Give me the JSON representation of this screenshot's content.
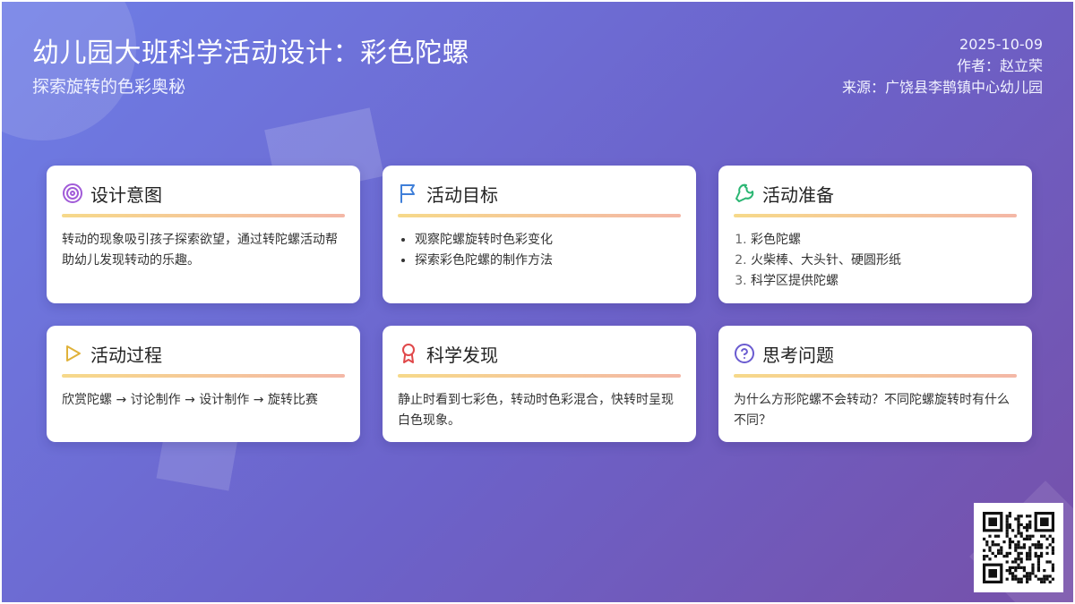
{
  "header": {
    "title": "幼儿园大班科学活动设计：彩色陀螺",
    "subtitle": "探索旋转的色彩奥秘",
    "date": "2025-10-09",
    "author": "作者：赵立荣",
    "source": "来源：广饶县李鹊镇中心幼儿园"
  },
  "cards": {
    "design": {
      "title": "设计意图",
      "icon": "target-icon",
      "text": "转动的现象吸引孩子探索欲望，通过转陀螺活动帮助幼儿发现转动的乐趣。"
    },
    "goals": {
      "title": "活动目标",
      "icon": "flag-icon",
      "items": [
        "观察陀螺旋转时色彩变化",
        "探索彩色陀螺的制作方法"
      ]
    },
    "prep": {
      "title": "活动准备",
      "icon": "wrench-icon",
      "items": [
        "彩色陀螺",
        "火柴棒、大头针、硬圆形纸",
        "科学区提供陀螺"
      ]
    },
    "process": {
      "title": "活动过程",
      "icon": "play-icon",
      "text": "欣赏陀螺 → 讨论制作 → 设计制作 → 旋转比赛"
    },
    "discovery": {
      "title": "科学发现",
      "icon": "award-icon",
      "text": "静止时看到七彩色，转动时色彩混合，快转时呈现白色现象。"
    },
    "questions": {
      "title": "思考问题",
      "icon": "help-circle-icon",
      "text": "为什么方形陀螺不会转动？不同陀螺旋转时有什么不同？"
    }
  },
  "colors": {
    "background_start": "#6f7ee6",
    "background_end": "#7650a9",
    "icon_target": "#a15bd8",
    "icon_flag": "#3f7fd9",
    "icon_wrench": "#2bb673",
    "icon_play": "#e0b23a",
    "icon_award": "#e0484a",
    "icon_help": "#6a5bd0",
    "accent_bar_start": "#f6d98a",
    "accent_bar_end": "#f4b7a6"
  },
  "qr": {
    "icon": "qr-code-icon"
  }
}
